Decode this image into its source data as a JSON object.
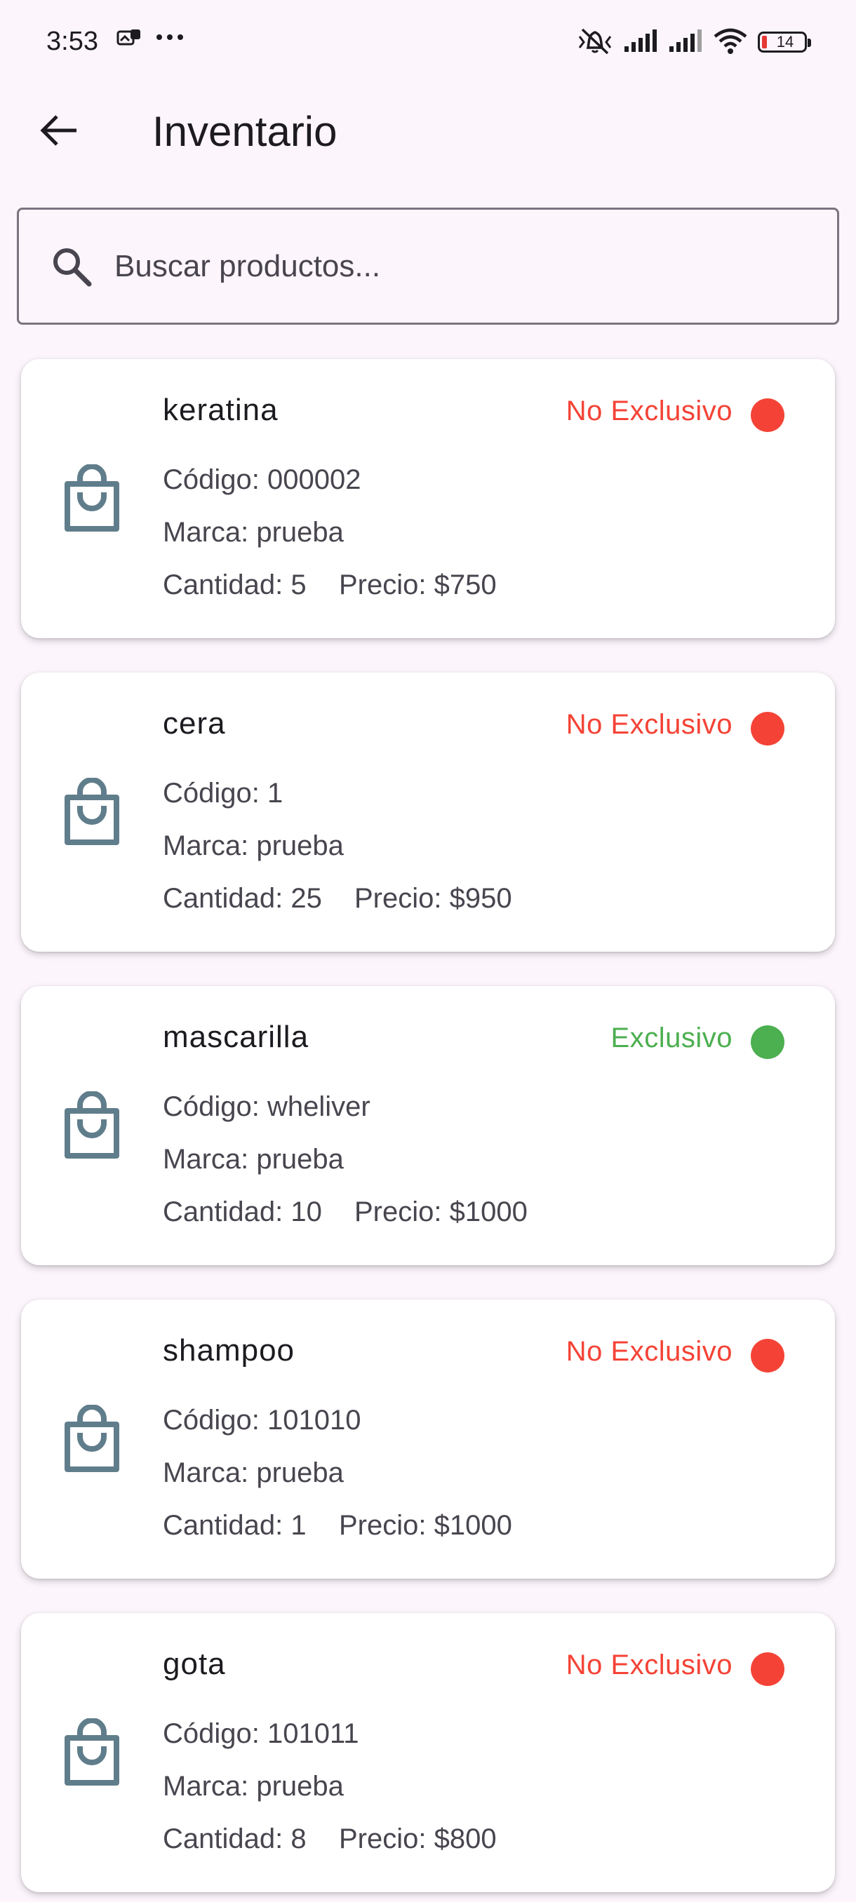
{
  "status_bar": {
    "time": "3:53",
    "battery": "14"
  },
  "app_bar": {
    "title": "Inventario"
  },
  "search": {
    "placeholder": "Buscar productos..."
  },
  "colors": {
    "exclusive": "#4CAF50",
    "non_exclusive": "#F44336",
    "icon": "#607D8B"
  },
  "products": [
    {
      "name": "keratina",
      "status": "No Exclusivo",
      "exclusive": false,
      "code": "Código: 000002",
      "brand": "Marca: prueba",
      "quantity": "Cantidad: 5",
      "price": "Precio: $750"
    },
    {
      "name": "cera",
      "status": "No Exclusivo",
      "exclusive": false,
      "code": "Código: 1",
      "brand": "Marca: prueba",
      "quantity": "Cantidad: 25",
      "price": "Precio: $950"
    },
    {
      "name": "mascarilla",
      "status": "Exclusivo",
      "exclusive": true,
      "code": "Código: wheliver",
      "brand": "Marca: prueba",
      "quantity": "Cantidad: 10",
      "price": "Precio: $1000"
    },
    {
      "name": "shampoo",
      "status": "No Exclusivo",
      "exclusive": false,
      "code": "Código: 101010",
      "brand": "Marca: prueba",
      "quantity": "Cantidad: 1",
      "price": "Precio: $1000"
    },
    {
      "name": "gota",
      "status": "No Exclusivo",
      "exclusive": false,
      "code": "Código: 101011",
      "brand": "Marca: prueba",
      "quantity": "Cantidad: 8",
      "price": "Precio: $800"
    }
  ]
}
